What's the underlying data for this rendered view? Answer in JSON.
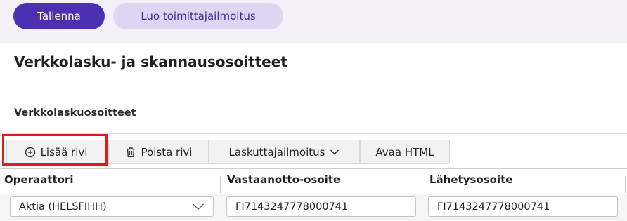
{
  "topbar": {
    "save_label": "Tallenna",
    "create_supplier_label": "Luo toimittajailmoitus"
  },
  "section": {
    "title": "Verkkolasku- ja skannausosoitteet",
    "subtitle": "Verkkolaskuosoitteet"
  },
  "toolbar": {
    "add_row_label": "Lisää rivi",
    "delete_row_label": "Poista rivi",
    "invoicer_notice_label": "Laskuttajailmoitus",
    "open_html_label": "Avaa HTML",
    "icons": [
      "plus-circle-icon",
      "trash-icon",
      "chevron-down-icon"
    ]
  },
  "grid": {
    "columns": [
      "Operaattori",
      "Vastaanotto-osoite",
      "Lähetysosoite"
    ],
    "rows": [
      {
        "operator": "Aktia (HELSFIHH)",
        "receive_address": "FI7143247778000741",
        "send_address": "FI7143247778000741"
      }
    ]
  },
  "colors": {
    "primary": "#4d2fb2",
    "secondary_bg": "#ddd5f2",
    "highlight": "#e01b1b"
  }
}
